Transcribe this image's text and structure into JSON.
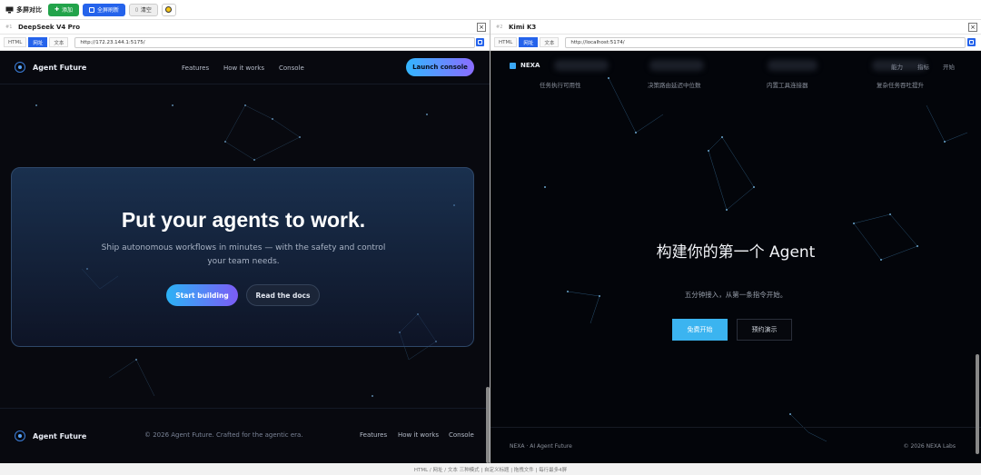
{
  "toolbar": {
    "title": "多屏对比",
    "add_label": "添加",
    "refresh_label": "全屏刷新",
    "clear_label": "清空"
  },
  "panes": [
    {
      "number": "#1",
      "title": "DeepSeek V4 Pro",
      "modes": [
        "HTML",
        "网址",
        "文本"
      ],
      "active_mode": "网址",
      "url": "http://172.23.144.1:5175/",
      "site": {
        "brand": "Agent Future",
        "nav": [
          "Features",
          "How it works",
          "Console"
        ],
        "cta": "Launch console",
        "hero_title": "Put your agents to work.",
        "hero_subtitle": "Ship autonomous workflows in minutes — with the safety and control your team needs.",
        "primary_button": "Start building",
        "secondary_button": "Read the docs",
        "footer_brand": "Agent Future",
        "footer_copyright": "© 2026 Agent Future. Crafted for the agentic era.",
        "footer_links": [
          "Features",
          "How it works",
          "Console"
        ]
      }
    },
    {
      "number": "#2",
      "title": "Kimi K3",
      "modes": [
        "HTML",
        "网址",
        "文本"
      ],
      "active_mode": "网址",
      "url": "http://localhost:5174/",
      "site": {
        "brand": "NEXA",
        "nav": [
          "能力",
          "指标",
          "开始"
        ],
        "features": [
          "任务执行可用性",
          "决策路由延迟中位数",
          "内置工具连接器",
          "复杂任务吞吐提升"
        ],
        "hero_title": "构建你的第一个 Agent",
        "hero_subtitle": "五分钟接入，从第一条指令开始。",
        "primary_button": "免费开始",
        "secondary_button": "预约演示",
        "footer_left": "NEXA · AI Agent Future",
        "footer_right": "© 2026 NEXA Labs"
      }
    }
  ],
  "status_bar": "HTML / 网址 / 文本 三种模式 | 自定义标题 | 拖拽文件 | 每行最多4屏"
}
